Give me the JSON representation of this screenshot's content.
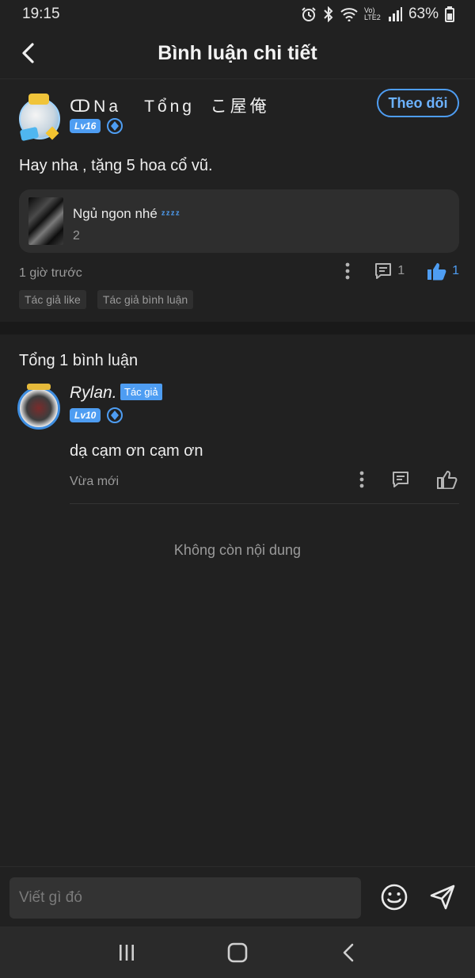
{
  "status_bar": {
    "time": "19:15",
    "network_label": "Vo) LTE2",
    "battery": "63%"
  },
  "header": {
    "title": "Bình luận chi tiết"
  },
  "post": {
    "user_name": "ↀNa   Tổng  こ屋俺",
    "level": "Lv16",
    "follow_label": "Theo dõi",
    "text": "Hay nha , tặng 5 hoa cổ vũ.",
    "ref_card": {
      "title": "Ngủ ngon nhé",
      "zzz": "ᶻᶻᶻᶻ",
      "count": "2"
    },
    "time": "1 giờ trước",
    "comment_count": "1",
    "like_count": "1",
    "tags": [
      "Tác giả like",
      "Tác giả bình luận"
    ]
  },
  "comments": {
    "total_label": "Tổng 1 bình luận",
    "items": [
      {
        "user_name": "Rylan.",
        "author_tag": "Tác giả",
        "level": "Lv10",
        "text": "dạ cạm ơn cạm ơn",
        "time": "Vừa mới"
      }
    ],
    "end_label": "Không còn nội dung"
  },
  "composer": {
    "placeholder": "Viết gì đó"
  },
  "colors": {
    "accent": "#4e9df2",
    "background": "#212121",
    "card": "#2e2e2e"
  },
  "icons": [
    "back-icon",
    "diamond-icon",
    "more-vert-icon",
    "comment-icon",
    "thumb-up-icon",
    "emoji-icon",
    "send-icon",
    "nav-recent-icon",
    "nav-home-icon",
    "nav-back-icon"
  ]
}
